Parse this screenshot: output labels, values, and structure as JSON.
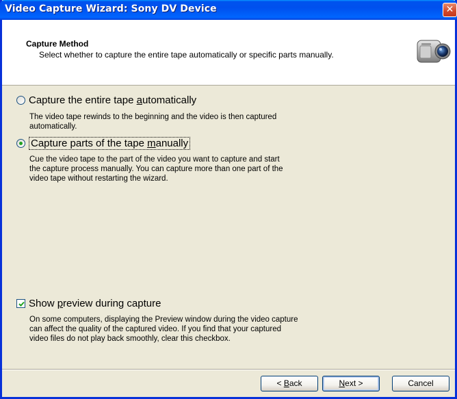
{
  "window": {
    "title": "Video Capture Wizard: Sony DV Device",
    "close_glyph": "✕"
  },
  "header": {
    "title": "Capture Method",
    "subtitle": "Select whether to capture the entire tape automatically or specific parts manually.",
    "icon": "camcorder-icon"
  },
  "options": [
    {
      "label_before": "Capture the entire tape ",
      "label_access": "a",
      "label_after": "utomatically",
      "selected": false,
      "description": [
        "The video tape rewinds to the beginning and the video is then captured",
        "automatically."
      ]
    },
    {
      "label_before": "Capture parts of the tape ",
      "label_access": "m",
      "label_after": "anually",
      "selected": true,
      "description": [
        "Cue the video tape to the part of the video you want to capture and start",
        "the capture process manually. You can capture more than one part of the",
        "video tape without restarting the wizard."
      ]
    }
  ],
  "preview": {
    "label_before": "Show ",
    "label_access": "p",
    "label_after": "review during capture",
    "checked": true,
    "description": [
      "On some computers, displaying the Preview window during the video capture",
      "can affect the quality of the captured video. If you find that your captured",
      "video files do not play back smoothly, clear this checkbox."
    ]
  },
  "buttons": {
    "back_prefix": "< ",
    "back_access": "B",
    "back_rest": "ack",
    "next_access": "N",
    "next_rest": "ext >",
    "cancel": "Cancel"
  },
  "colors": {
    "title_bar": "#0053ee",
    "window_bg": "#ece9d8",
    "radio_dot": "#21a121",
    "check_mark": "#21a121"
  }
}
